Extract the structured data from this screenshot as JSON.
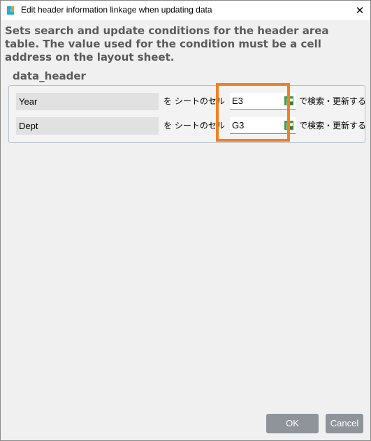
{
  "window": {
    "title": "Edit header information linkage when updating data",
    "close_glyph": "✕"
  },
  "description": "Sets search and update conditions for the header area table. The value used for the condition must be a cell address on the layout sheet.",
  "section": {
    "title": "data_header"
  },
  "rows": [
    {
      "field": "Year",
      "prefix": "を シートのセル",
      "cell": "E3",
      "suffix": "で検索・更新する"
    },
    {
      "field": "Dept",
      "prefix": "を シートのセル",
      "cell": "G3",
      "suffix": "で検索・更新する"
    }
  ],
  "buttons": {
    "ok": "OK",
    "cancel": "Cancel"
  },
  "colors": {
    "highlight": "#f08022",
    "button_bg": "#8f949b",
    "grid_icon": "#4caf50"
  },
  "icons": {
    "app": "app-logo-icon",
    "cell_picker": "grid-select-icon"
  }
}
